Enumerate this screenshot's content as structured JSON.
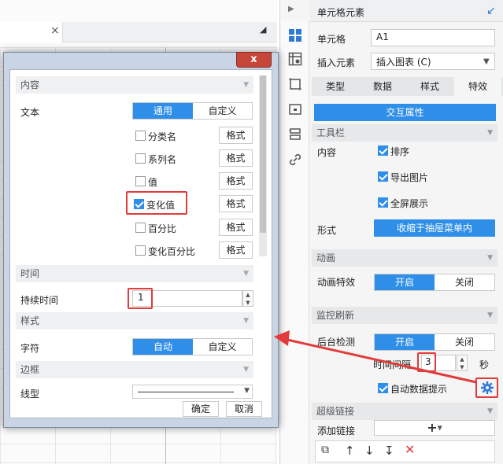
{
  "background_editor": {
    "tab_close": "×"
  },
  "panel": {
    "title": "单元格元素",
    "cell_label": "单元格",
    "cell_value": "A1",
    "insert_label": "插入元素",
    "insert_value": "插入图表 (C)",
    "tabs": [
      "类型",
      "数据",
      "样式",
      "特效"
    ],
    "active_tab": "特效",
    "interact_button": "交互属性",
    "toolbar_section": "工具栏",
    "content_label": "内容",
    "toolbar_options": [
      {
        "label": "排序",
        "checked": true
      },
      {
        "label": "导出图片",
        "checked": true
      },
      {
        "label": "全屏展示",
        "checked": true
      }
    ],
    "form_label": "形式",
    "form_value": "收缩于抽屉菜单内",
    "animation_section": "动画",
    "animation_label": "动画特效",
    "animation_on": "开启",
    "animation_off": "关闭",
    "monitor_section": "监控刷新",
    "bg_check_label": "后台检测",
    "bg_check_on": "开启",
    "bg_check_off": "关闭",
    "interval_label": "时间间隔",
    "interval_value": "3",
    "interval_unit": "秒",
    "auto_tip_label": "自动数据提示",
    "auto_tip_checked": true,
    "hyperlink_section": "超级链接",
    "add_link_label": "添加链接",
    "add_link_btn": "+",
    "accent_color": "#2e8ee8"
  },
  "dialog": {
    "close": "x",
    "content_section": "内容",
    "text_label": "文本",
    "text_mode_general": "通用",
    "text_mode_custom": "自定义",
    "format_label": "格式",
    "items": [
      {
        "label": "分类名",
        "checked": false
      },
      {
        "label": "系列名",
        "checked": false
      },
      {
        "label": "值",
        "checked": false
      },
      {
        "label": "变化值",
        "checked": true
      },
      {
        "label": "百分比",
        "checked": false
      },
      {
        "label": "变化百分比",
        "checked": false
      }
    ],
    "time_section": "时间",
    "duration_label": "持续时间",
    "duration_value": "1",
    "style_section": "样式",
    "char_label": "字符",
    "char_auto": "自动",
    "char_custom": "自定义",
    "border_section": "边框",
    "line_label": "线型",
    "ok": "确定",
    "cancel": "取消",
    "highlight_color": "#e23b3b"
  }
}
